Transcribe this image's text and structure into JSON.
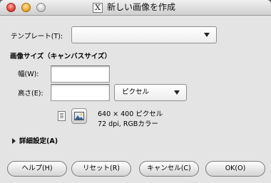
{
  "window": {
    "title": "新しい画像を作成",
    "icon": "X"
  },
  "template": {
    "label": "テンプレート(T):",
    "value": ""
  },
  "image_size": {
    "heading": "画像サイズ（キャンバスサイズ）",
    "width_label": "幅(W):",
    "width_value": "",
    "height_label": "高さ(E):",
    "height_value": "",
    "unit": "ピクセル"
  },
  "info": {
    "dimensions": "640 × 400 ピクセル",
    "resolution": "72 dpi, RGBカラー"
  },
  "advanced": {
    "label": "詳細設定(A)"
  },
  "buttons": {
    "help": "ヘルプ(H)",
    "reset": "リセット(R)",
    "cancel": "キャンセル(C)",
    "ok": "OK(O)"
  }
}
